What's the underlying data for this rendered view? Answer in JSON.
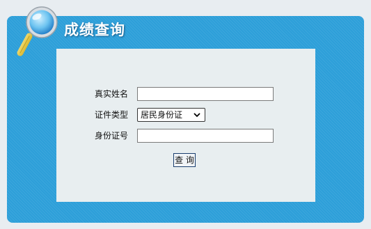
{
  "header": {
    "title": "成绩查询",
    "icon": "magnifier-icon"
  },
  "form": {
    "name_label": "真实姓名",
    "name_value": "",
    "id_type_label": "证件类型",
    "id_type_selected": "居民身份证",
    "id_number_label": "身份证号",
    "id_number_value": "",
    "submit_label": "查 询"
  },
  "colors": {
    "panel": "#2d9fd9",
    "content_bg": "#e8eef0",
    "page_bg": "#e8edf1"
  }
}
